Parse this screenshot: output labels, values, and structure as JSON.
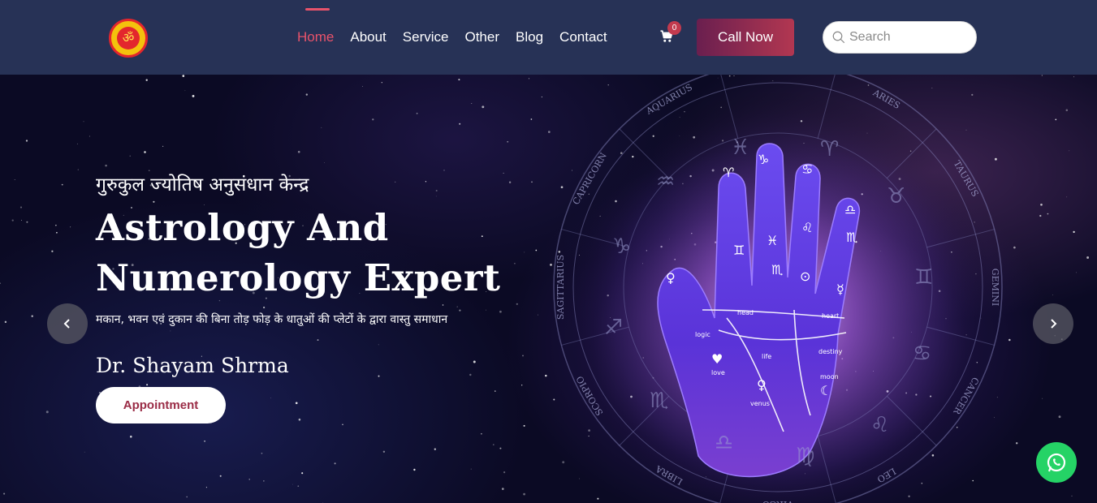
{
  "header": {
    "nav": [
      {
        "label": "Home",
        "active": true
      },
      {
        "label": "About"
      },
      {
        "label": "Service"
      },
      {
        "label": "Other"
      },
      {
        "label": "Blog"
      },
      {
        "label": "Contact"
      }
    ],
    "cart_count": "0",
    "call_label": "Call Now",
    "search_placeholder": "Search",
    "logo_icon": "om-symbol"
  },
  "hero": {
    "subtitle": "गुरुकुल ज्योतिष अनुसंधान केन्द्र",
    "title_line1": "Astrology And",
    "title_line2": "Numerology Expert",
    "tagline": "मकान, भवन एवं दुकान की बिना तोड़ फोड़ के धातुओं की प्लेटों के द्वारा वास्तु समाधान",
    "doctor": "Dr. Shayam Shrma",
    "appointment_label": "Appointment",
    "zodiac_ring": [
      "PISCES",
      "ARIES",
      "TAURUS",
      "GEMINI",
      "CANCER",
      "LEO",
      "VIRGO",
      "LIBRA",
      "SCORPIO",
      "SAGITTARIUS",
      "CAPRICORN",
      "AQUARIUS"
    ],
    "palm_labels": [
      "head",
      "heart",
      "logic",
      "life",
      "destiny",
      "love",
      "moon",
      "venus"
    ]
  },
  "colors": {
    "header_bg": "#273256",
    "accent": "#e8536b",
    "call_gradient_start": "#6a1f4f",
    "call_gradient_end": "#b23751",
    "whatsapp": "#25d366"
  }
}
